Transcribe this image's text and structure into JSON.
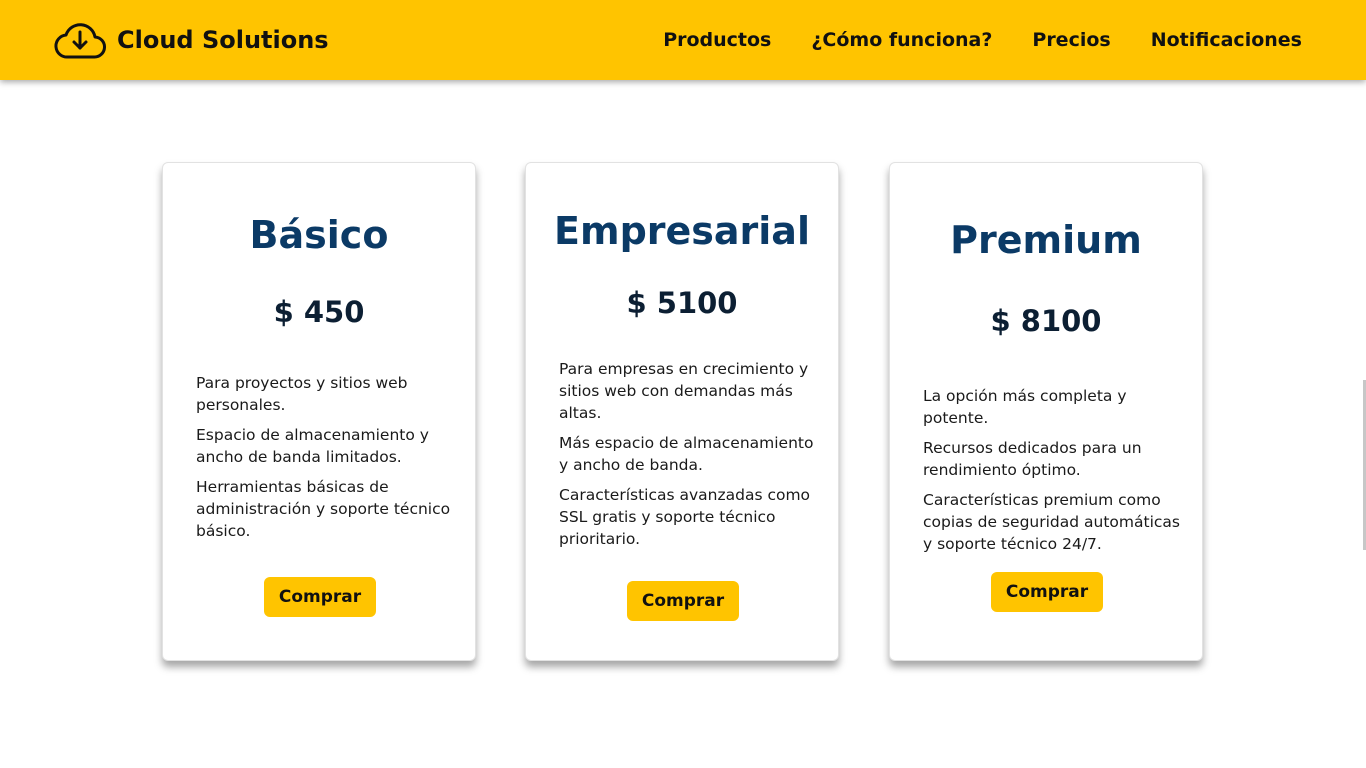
{
  "header": {
    "brand": "Cloud Solutions",
    "brand_icon": "cloud-download-icon",
    "nav": [
      {
        "label": "Productos"
      },
      {
        "label": "¿Cómo funciona?"
      },
      {
        "label": "Precios"
      },
      {
        "label": "Notificaciones"
      }
    ]
  },
  "colors": {
    "accent": "#ffc400",
    "title": "#0b3a66",
    "price": "#0c1f33"
  },
  "plans": [
    {
      "name": "Básico",
      "price": "$ 450",
      "features": [
        "Para proyectos y sitios web personales.",
        "Espacio de almacenamiento y ancho de banda limitados.",
        "Herramientas básicas de administración y soporte técnico básico."
      ],
      "button": "Comprar"
    },
    {
      "name": "Empresarial",
      "price": "$ 5100",
      "features": [
        "Para empresas en crecimiento y sitios web con demandas más altas.",
        "Más espacio de almacenamiento y ancho de banda.",
        "Características avanzadas como SSL gratis y soporte técnico prioritario."
      ],
      "button": "Comprar"
    },
    {
      "name": "Premium",
      "price": "$ 8100",
      "features": [
        "La opción más completa y potente.",
        "Recursos dedicados para un rendimiento óptimo.",
        "Características premium como copias de seguridad automáticas y soporte técnico 24/7."
      ],
      "button": "Comprar"
    }
  ]
}
